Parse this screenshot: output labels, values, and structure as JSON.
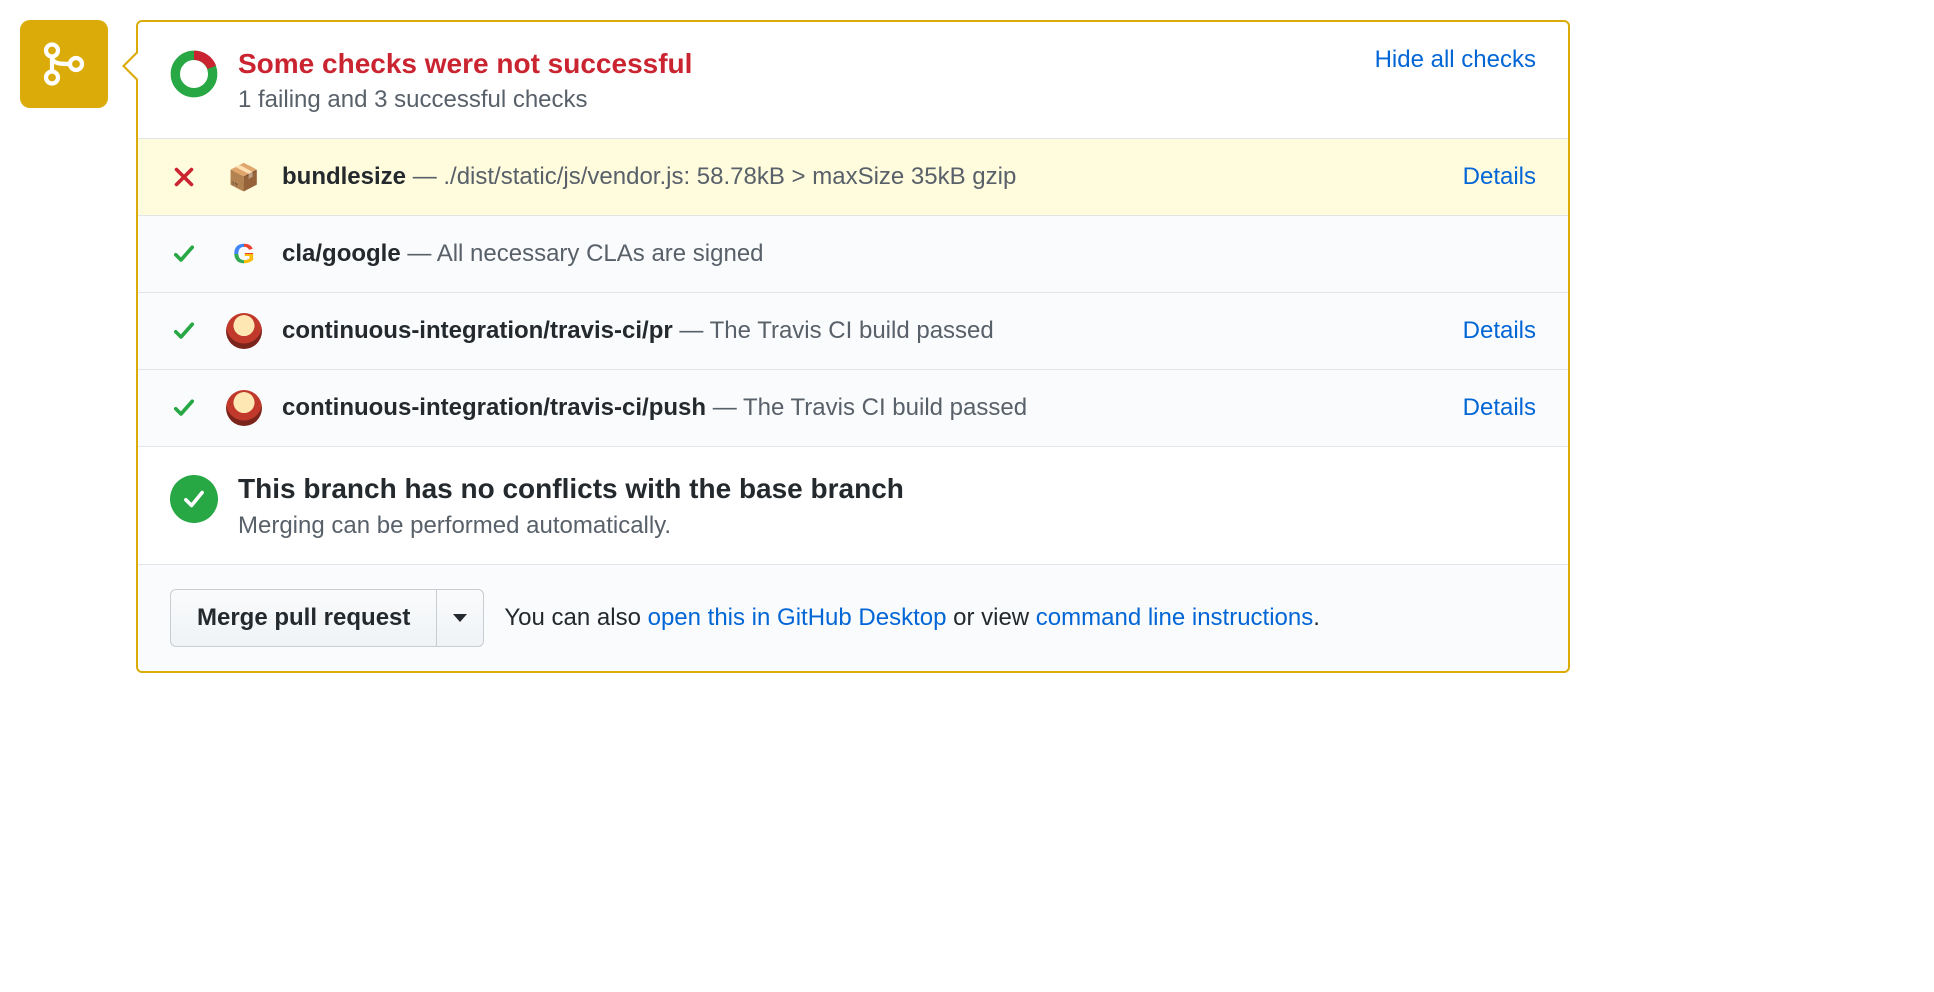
{
  "header": {
    "title": "Some checks were not successful",
    "subtitle": "1 failing and 3 successful checks",
    "toggle_label": "Hide all checks"
  },
  "checks": [
    {
      "status": "fail",
      "app": "bundlesize",
      "app_icon": "package",
      "name": "bundlesize",
      "message": "./dist/static/js/vendor.js: 58.78kB > maxSize 35kB gzip",
      "details_label": "Details",
      "has_details": true
    },
    {
      "status": "pass",
      "app": "google",
      "app_icon": "google-g",
      "name": "cla/google",
      "message": "All necessary CLAs are signed",
      "has_details": false
    },
    {
      "status": "pass",
      "app": "travis",
      "app_icon": "travis",
      "name": "continuous-integration/travis-ci/pr",
      "message": "The Travis CI build passed",
      "details_label": "Details",
      "has_details": true
    },
    {
      "status": "pass",
      "app": "travis",
      "app_icon": "travis",
      "name": "continuous-integration/travis-ci/push",
      "message": "The Travis CI build passed",
      "details_label": "Details",
      "has_details": true
    }
  ],
  "merge_status": {
    "title": "This branch has no conflicts with the base branch",
    "subtitle": "Merging can be performed automatically."
  },
  "footer": {
    "merge_button": "Merge pull request",
    "text_prefix": "You can also ",
    "desktop_link": "open this in GitHub Desktop",
    "text_middle": " or view ",
    "cli_link": "command line instructions",
    "text_suffix": "."
  }
}
